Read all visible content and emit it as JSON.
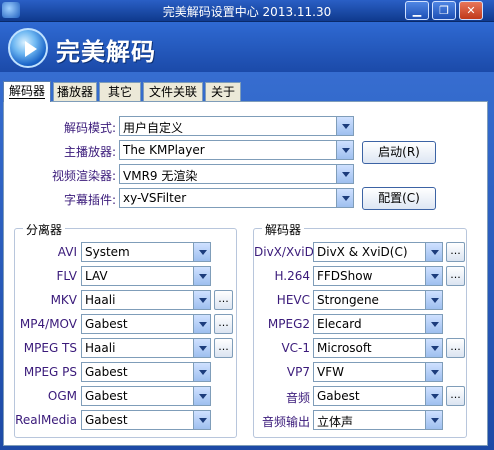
{
  "window": {
    "title": "完美解码设置中心 2013.11.30",
    "brand": "完美解码"
  },
  "tabs": [
    {
      "label": "解码器",
      "active": true
    },
    {
      "label": "播放器",
      "active": false
    },
    {
      "label": "其它",
      "active": false
    },
    {
      "label": "文件关联",
      "active": false
    },
    {
      "label": "关于",
      "active": false
    }
  ],
  "top": {
    "decode_mode": {
      "label": "解码模式:",
      "value": "用户自定义"
    },
    "main_player": {
      "label": "主播放器:",
      "value": "The KMPlayer"
    },
    "video_renderer": {
      "label": "视频渲染器:",
      "value": "VMR9 无渲染"
    },
    "subtitle_plugin": {
      "label": "字幕插件:",
      "value": "xy-VSFilter"
    },
    "launch_button": "启动(R)",
    "config_button": "配置(C)"
  },
  "splitter": {
    "title": "分离器",
    "rows": [
      {
        "label": "AVI",
        "value": "System"
      },
      {
        "label": "FLV",
        "value": "LAV"
      },
      {
        "label": "MKV",
        "value": "Haali"
      },
      {
        "label": "MP4/MOV",
        "value": "Gabest"
      },
      {
        "label": "MPEG TS",
        "value": "Haali"
      },
      {
        "label": "MPEG PS",
        "value": "Gabest"
      },
      {
        "label": "OGM",
        "value": "Gabest"
      },
      {
        "label": "RealMedia",
        "value": "Gabest"
      }
    ]
  },
  "decoder": {
    "title": "解码器",
    "rows": [
      {
        "label": "DivX/XviD",
        "value": "DivX & XviD(C)"
      },
      {
        "label": "H.264",
        "value": "FFDShow"
      },
      {
        "label": "HEVC",
        "value": "Strongene"
      },
      {
        "label": "MPEG2",
        "value": "Elecard"
      },
      {
        "label": "VC-1",
        "value": "Microsoft"
      },
      {
        "label": "VP7",
        "value": "VFW"
      },
      {
        "label": "音频",
        "value": "Gabest"
      },
      {
        "label": "音频输出",
        "value": "立体声"
      }
    ]
  },
  "more_button": "..."
}
